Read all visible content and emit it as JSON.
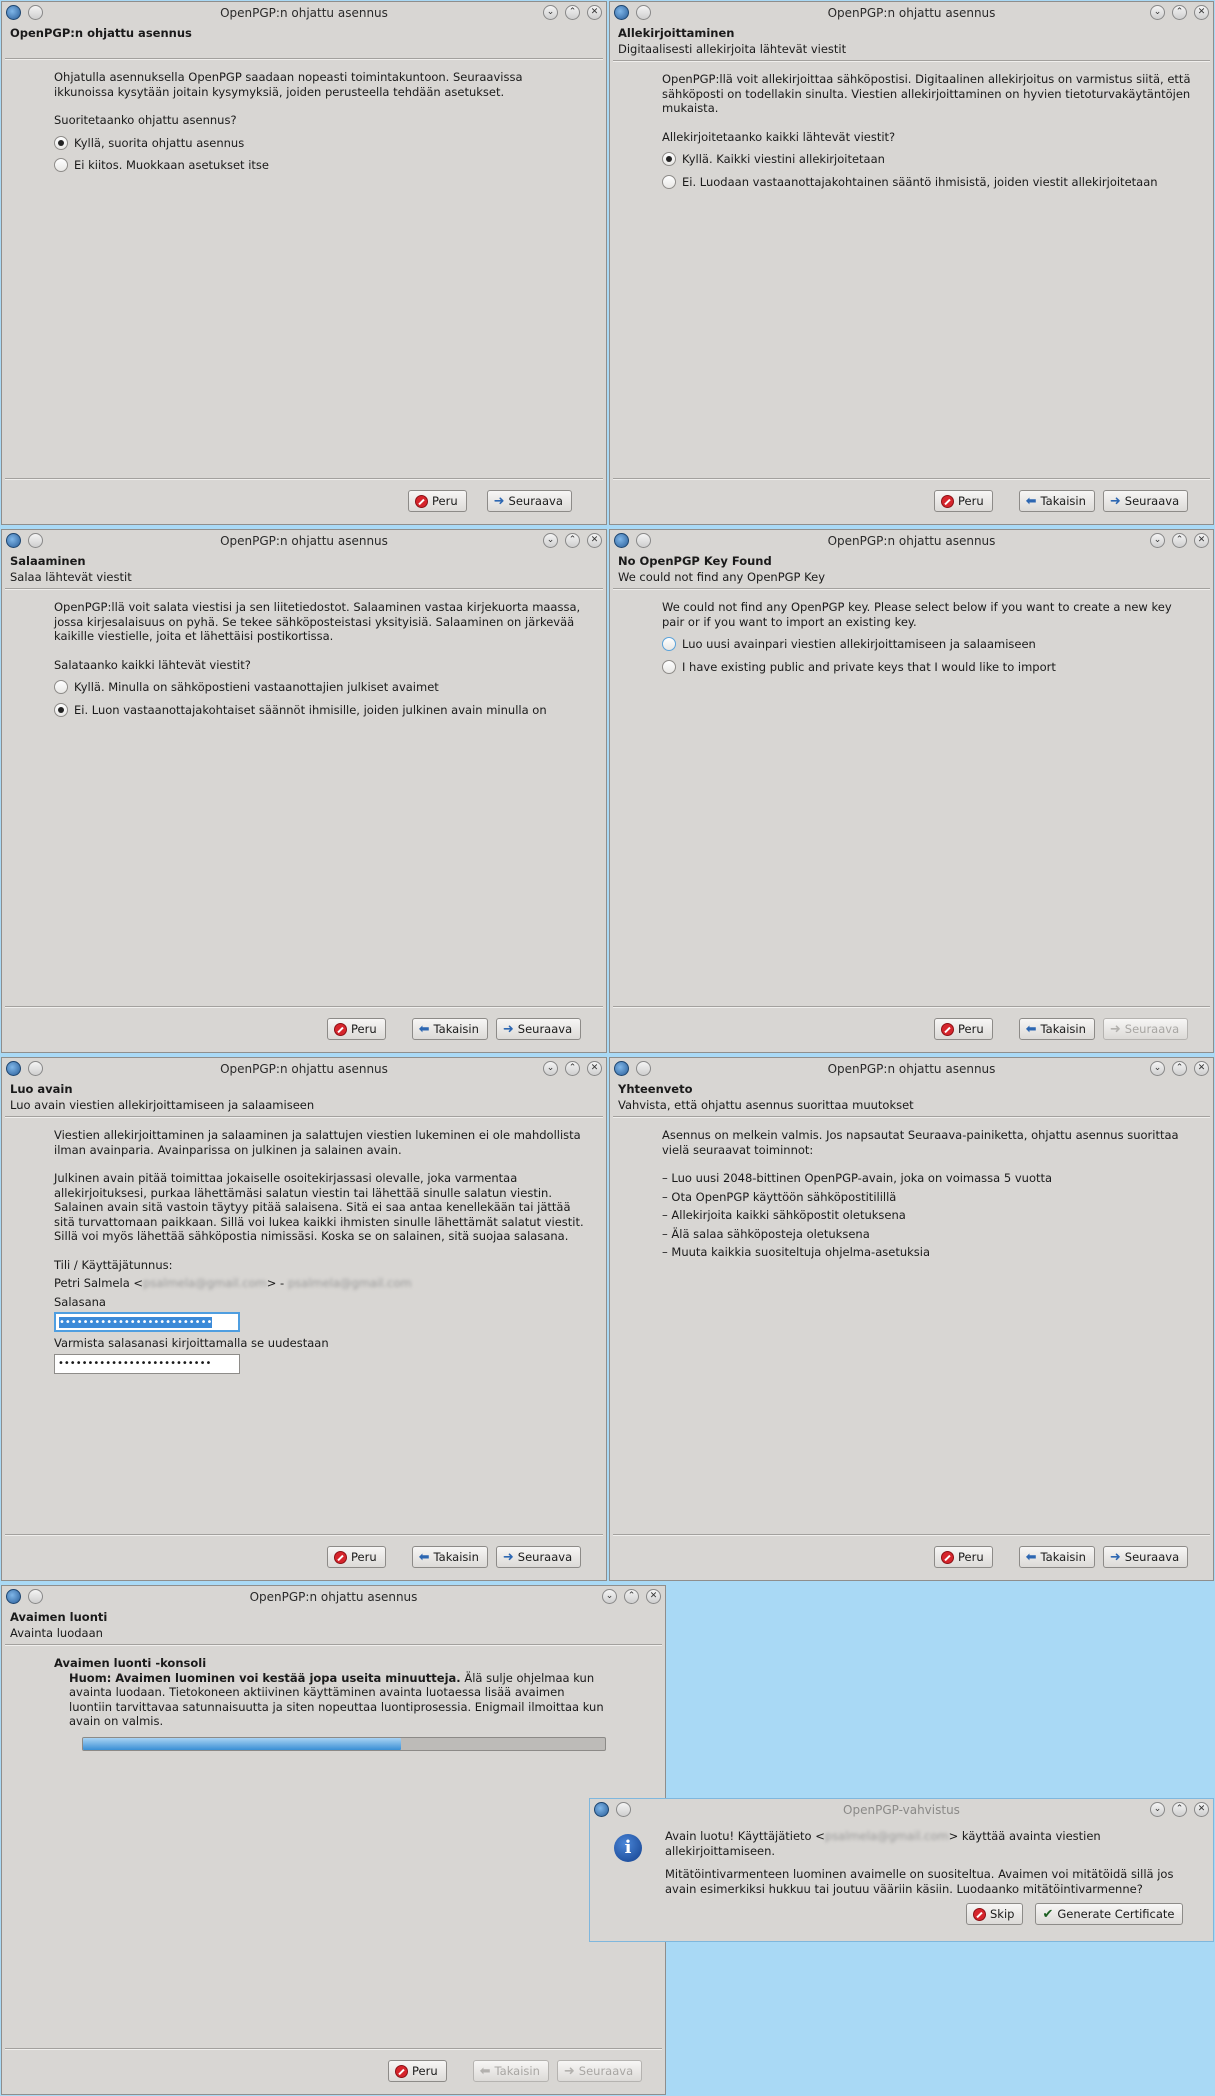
{
  "colors": {
    "desktop": "#a9d9f5",
    "window_bg": "#d8d6d3",
    "progress_fill": "#3a8fd5",
    "stop_icon": "#d6252c"
  },
  "icons": {
    "app": "openpgp-app-icon",
    "minimize": "chevron-down-icon",
    "maximize": "chevron-up-icon",
    "close": "close-icon",
    "cancel": "stop-icon",
    "back": "arrow-left-icon",
    "next": "arrow-right-icon",
    "info": "info-icon",
    "confirm": "check-icon"
  },
  "buttons": {
    "cancel": "Peru",
    "back": "Takaisin",
    "next": "Seuraava"
  },
  "w1": {
    "title": "OpenPGP:n ohjattu asennus",
    "header_title": "OpenPGP:n ohjattu asennus",
    "intro": "Ohjatulla asennuksella OpenPGP saadaan nopeasti toimintakuntoon. Seuraavissa ikkunoissa kysytään joitain kysymyksiä, joiden perusteella tehdään asetukset.",
    "question": "Suoritetaanko ohjattu asennus?",
    "opt1": "Kyllä, suorita ohjattu asennus",
    "opt2": "Ei kiitos. Muokkaan asetukset itse"
  },
  "w2": {
    "title": "OpenPGP:n ohjattu asennus",
    "header_title": "Allekirjoittaminen",
    "header_sub": "Digitaalisesti allekirjoita lähtevät viestit",
    "intro": "OpenPGP:llä voit allekirjoittaa sähköpostisi. Digitaalinen allekirjoitus on varmistus siitä, että sähköposti on todellakin sinulta. Viestien allekirjoittaminen on hyvien tietoturvakäytäntöjen mukaista.",
    "question": "Allekirjoitetaanko kaikki lähtevät viestit?",
    "opt1": "Kyllä. Kaikki viestini allekirjoitetaan",
    "opt2": "Ei. Luodaan vastaanottajakohtainen sääntö ihmisistä, joiden viestit allekirjoitetaan"
  },
  "w3": {
    "title": "OpenPGP:n ohjattu asennus",
    "header_title": "Salaaminen",
    "header_sub": "Salaa lähtevät viestit",
    "intro": "OpenPGP:llä voit salata viestisi ja sen liitetiedostot. Salaaminen vastaa kirjekuorta maassa, jossa kirjesalaisuus on pyhä. Se tekee sähköposteistasi yksityisiä. Salaaminen on järkevää kaikille viestielle, joita et lähettäisi postikortissa.",
    "question": "Salataanko kaikki lähtevät viestit?",
    "opt1": "Kyllä. Minulla on sähköpostieni vastaanottajien julkiset avaimet",
    "opt2": "Ei. Luon vastaanottajakohtaiset säännöt ihmisille, joiden julkinen avain minulla on"
  },
  "w4": {
    "title": "OpenPGP:n ohjattu asennus",
    "header_title": "No OpenPGP Key Found",
    "header_sub": "We could not find any OpenPGP Key",
    "intro": "We could not find any OpenPGP key. Please select below if you want to create a new key pair or if you want to import an existing key.",
    "opt1": "Luo uusi avainpari viestien allekirjoittamiseen ja salaamiseen",
    "opt2": "I have existing public and private keys that I would like to import"
  },
  "w5": {
    "title": "OpenPGP:n ohjattu asennus",
    "header_title": "Luo avain",
    "header_sub": "Luo avain viestien allekirjoittamiseen ja salaamiseen",
    "intro1": "Viestien allekirjoittaminen ja salaaminen ja salattujen viestien lukeminen ei ole mahdollista ilman avainparia. Avainparissa on julkinen ja salainen avain.",
    "intro2": "Julkinen avain pitää toimittaa jokaiselle osoitekirjassasi olevalle, joka varmentaa allekirjoituksesi, purkaa lähettämäsi salatun viestin tai lähettää sinulle salatun viestin. Salainen avain sitä vastoin täytyy pitää salaisena. Sitä ei saa antaa kenellekään tai jättää sitä turvattomaan paikkaan. Sillä voi lukea kaikki ihmisten sinulle lähettämät salatut viestit. Sillä voi myös lähettää sähköpostia nimissäsi. Koska se on salainen, sitä suojaa salasana.",
    "account_label": "Tili / Käyttäjätunnus:",
    "account_name": "Petri Salmela <",
    "account_email_hidden": "psalmela@gmail.com",
    "account_mid": "> - ",
    "account_email_hidden2": "psalmela@gmail.com",
    "password_label": "Salasana",
    "password_value": "••••••••••••••••••••••••••",
    "confirm_label": "Varmista salasanasi kirjoittamalla se uudestaan",
    "confirm_value": "••••••••••••••••••••••••••"
  },
  "w6": {
    "title": "OpenPGP:n ohjattu asennus",
    "header_title": "Yhteenveto",
    "header_sub": "Vahvista, että ohjattu asennus suorittaa muutokset",
    "intro": "Asennus on melkein valmis. Jos napsautat Seuraava-painiketta, ohjattu asennus suorittaa vielä seuraavat toiminnot:",
    "items": [
      "– Luo uusi 2048-bittinen OpenPGP-avain, joka on voimassa 5 vuotta",
      "– Ota OpenPGP käyttöön sähköpostitilillä",
      "– Allekirjoita kaikki sähköpostit oletuksena",
      "– Älä salaa sähköposteja oletuksena",
      "– Muuta kaikkia suositeltuja ohjelma-asetuksia"
    ]
  },
  "w7": {
    "title": "OpenPGP:n ohjattu asennus",
    "header_title": "Avaimen luonti",
    "header_sub": "Avainta luodaan",
    "console_title": "Avaimen luonti -konsoli",
    "note_bold": "Huom: Avaimen luominen voi kestää jopa useita minuutteja.",
    "note_rest": " Älä sulje ohjelmaa kun avainta luodaan. Tietokoneen aktiivinen käyttäminen avainta luotaessa lisää avaimen luontiin tarvittavaa satunnaisuutta ja siten nopeuttaa luontiprosessia. Enigmail ilmoittaa kun avain on valmis.",
    "progress": 0.61
  },
  "w8": {
    "title": "OpenPGP-vahvistus",
    "msg1_pre": "Avain luotu! Käyttäjätieto <",
    "msg1_hidden": "psalmela@gmail.com",
    "msg1_post": "> käyttää avainta viestien allekirjoittamiseen.",
    "msg2": "Mitätöintivarmenteen luominen avaimelle on suositeltua. Avaimen voi mitätöidä sillä jos avain esimerkiksi hukkuu tai joutuu vääriin käsiin. Luodaanko mitätöintivarmenne?",
    "skip": "Skip",
    "generate": "Generate Certificate"
  }
}
